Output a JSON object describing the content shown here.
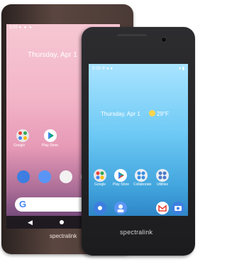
{
  "back_phone": {
    "status_time": "5:05",
    "date_text": "Thursday, Apr 1",
    "apps": [
      {
        "label": "Google"
      },
      {
        "label": "Play Store"
      }
    ],
    "brand": "spectralink"
  },
  "front_phone": {
    "status_time": "8:29",
    "date_text": "Thursday, Apr 1",
    "temperature": "29°F",
    "apps": [
      {
        "label": "Google",
        "icon": "google-folder-icon"
      },
      {
        "label": "Play Store",
        "icon": "play-store-icon"
      },
      {
        "label": "Collaborate",
        "icon": "collaborate-icon"
      },
      {
        "label": "Utilities",
        "icon": "utilities-icon"
      }
    ],
    "dock": [
      {
        "icon": "phone-icon"
      },
      {
        "icon": "contacts-icon"
      },
      {
        "icon": "gmail-icon"
      },
      {
        "icon": "camera-icon"
      }
    ],
    "brand": "spectralink"
  }
}
